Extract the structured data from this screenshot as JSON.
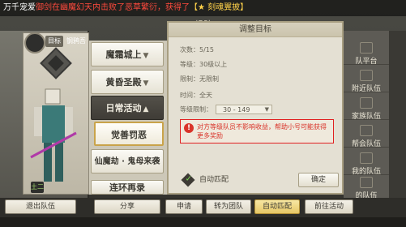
{
  "marquee": {
    "part1": "万千宠爱",
    "part2": "御剑在幽魔幻天内击败了恶草繁衍，获得了",
    "part3": "【★ 刻魂翼披】"
  },
  "window": {
    "title": "组队"
  },
  "character": {
    "leader_tag": "目标",
    "name": "钢鸦吾",
    "level": "土二"
  },
  "activities": [
    {
      "label": "魔霜城上",
      "arrow": "▼"
    },
    {
      "label": "黄昏圣殿",
      "arrow": "▼"
    },
    {
      "label": "日常活动",
      "arrow": "▲"
    },
    {
      "label": "觉善罚恶",
      "arrow": ""
    },
    {
      "label": "仙魔劫 · 鬼母来袭",
      "arrow": ""
    },
    {
      "label": "连环再录",
      "arrow": ""
    }
  ],
  "dialog": {
    "title": "调整目标",
    "count_label": "次数：",
    "count_value": "5/15",
    "level_label": "等级：",
    "level_value": "30级以上",
    "limit_label": "限制：",
    "limit_value": "无限制",
    "time_label": "时间：",
    "time_value": "全天",
    "range_label": "等级限制：",
    "range_value": "30 - 149",
    "warning": "对方等级队员不影响收益，帮助小号可能获得更多奖励",
    "auto_match": "自动匹配",
    "confirm": "确定"
  },
  "side_tabs": [
    {
      "label": "队平台"
    },
    {
      "label": "附近队伍"
    },
    {
      "label": "家族队伍"
    },
    {
      "label": "帮会队伍"
    },
    {
      "label": "我的队伍"
    },
    {
      "label": "的队伍"
    }
  ],
  "bottom": {
    "leave": "退出队伍",
    "share": "分享",
    "apply": "申请",
    "convert": "转为团队",
    "auto_match": "自动匹配",
    "goto_target": "前往活动"
  },
  "colors": {
    "warning_red": "#d9342a",
    "highlight_gold": "#e6c766"
  }
}
